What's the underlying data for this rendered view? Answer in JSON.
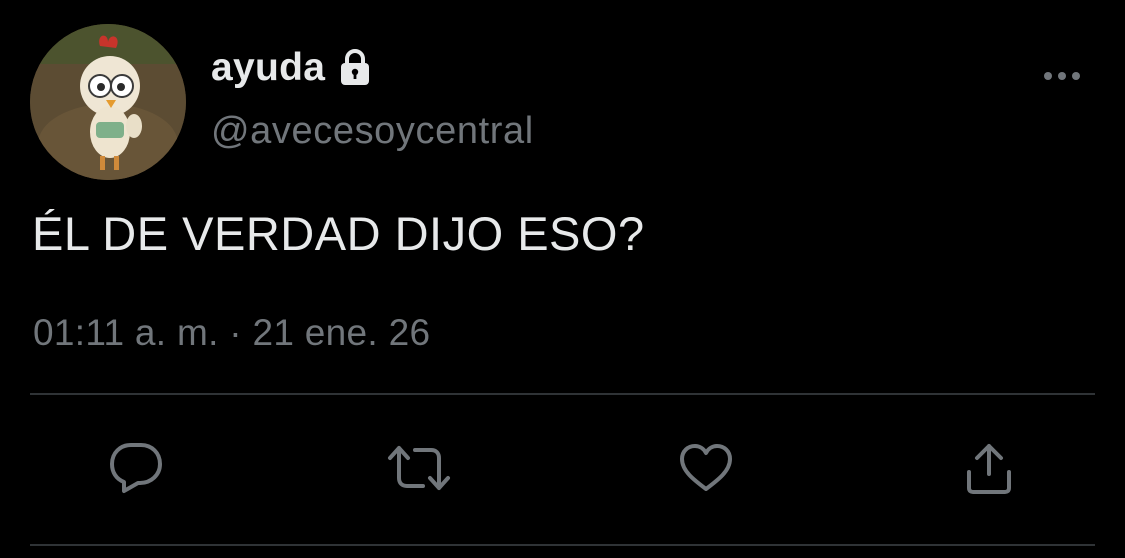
{
  "tweet": {
    "author": {
      "display_name": "ayuda",
      "handle": "@avecesoycentral",
      "protected": true,
      "avatar_icon": "chicken-avatar"
    },
    "text": "ÉL DE VERDAD DIJO ESO?",
    "timestamp": "01:11 a. m. · 21 ene. 26",
    "actions": [
      {
        "name": "reply",
        "icon": "comment-bubble-icon"
      },
      {
        "name": "retweet",
        "icon": "retweet-icon"
      },
      {
        "name": "like",
        "icon": "heart-icon"
      },
      {
        "name": "share",
        "icon": "share-upload-icon"
      }
    ],
    "more_icon": "ellipsis-icon"
  },
  "colors": {
    "background": "#000000",
    "primary_text": "#e7e9ea",
    "secondary_text": "#71767b",
    "divider": "#2f3336"
  }
}
